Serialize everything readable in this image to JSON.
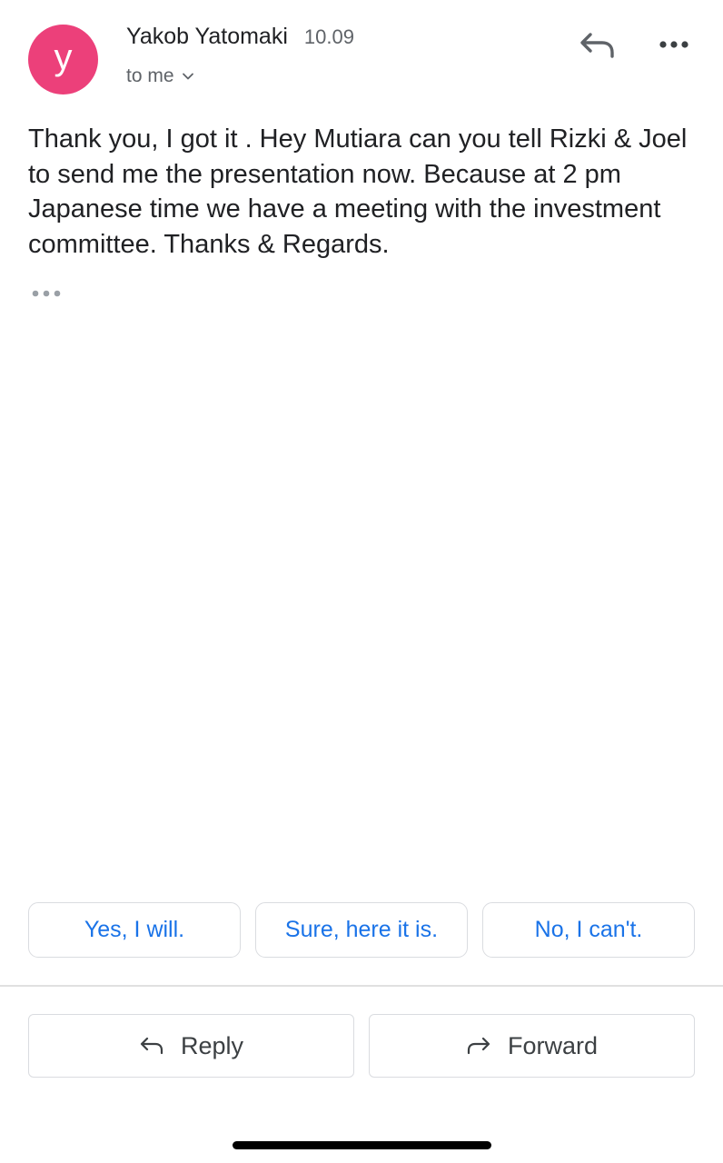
{
  "message": {
    "sender_initial": "y",
    "sender_name": "Yakob Yatomaki",
    "time": "10.09",
    "recipient_label": "to me",
    "body": "Thank you, I got it . Hey Mutiara can you tell Rizki & Joel to send me the presentation now. Because at 2 pm Japanese time we have a meeting with the investment committee. Thanks & Regards."
  },
  "smart_replies": [
    "Yes, I will.",
    "Sure, here it is.",
    "No, I can't."
  ],
  "actions": {
    "reply_label": "Reply",
    "forward_label": "Forward"
  },
  "colors": {
    "avatar": "#ec407a",
    "smart_reply_text": "#1a73e8",
    "primary_text": "#202124",
    "secondary_text": "#5f6368"
  },
  "icons": {
    "header_reply": "reply-icon",
    "overflow": "more-options-icon",
    "recipient_expand": "chevron-down-icon",
    "trimmed_content": "more-horizontal-icon",
    "reply_button": "reply-icon",
    "forward_button": "forward-icon"
  }
}
